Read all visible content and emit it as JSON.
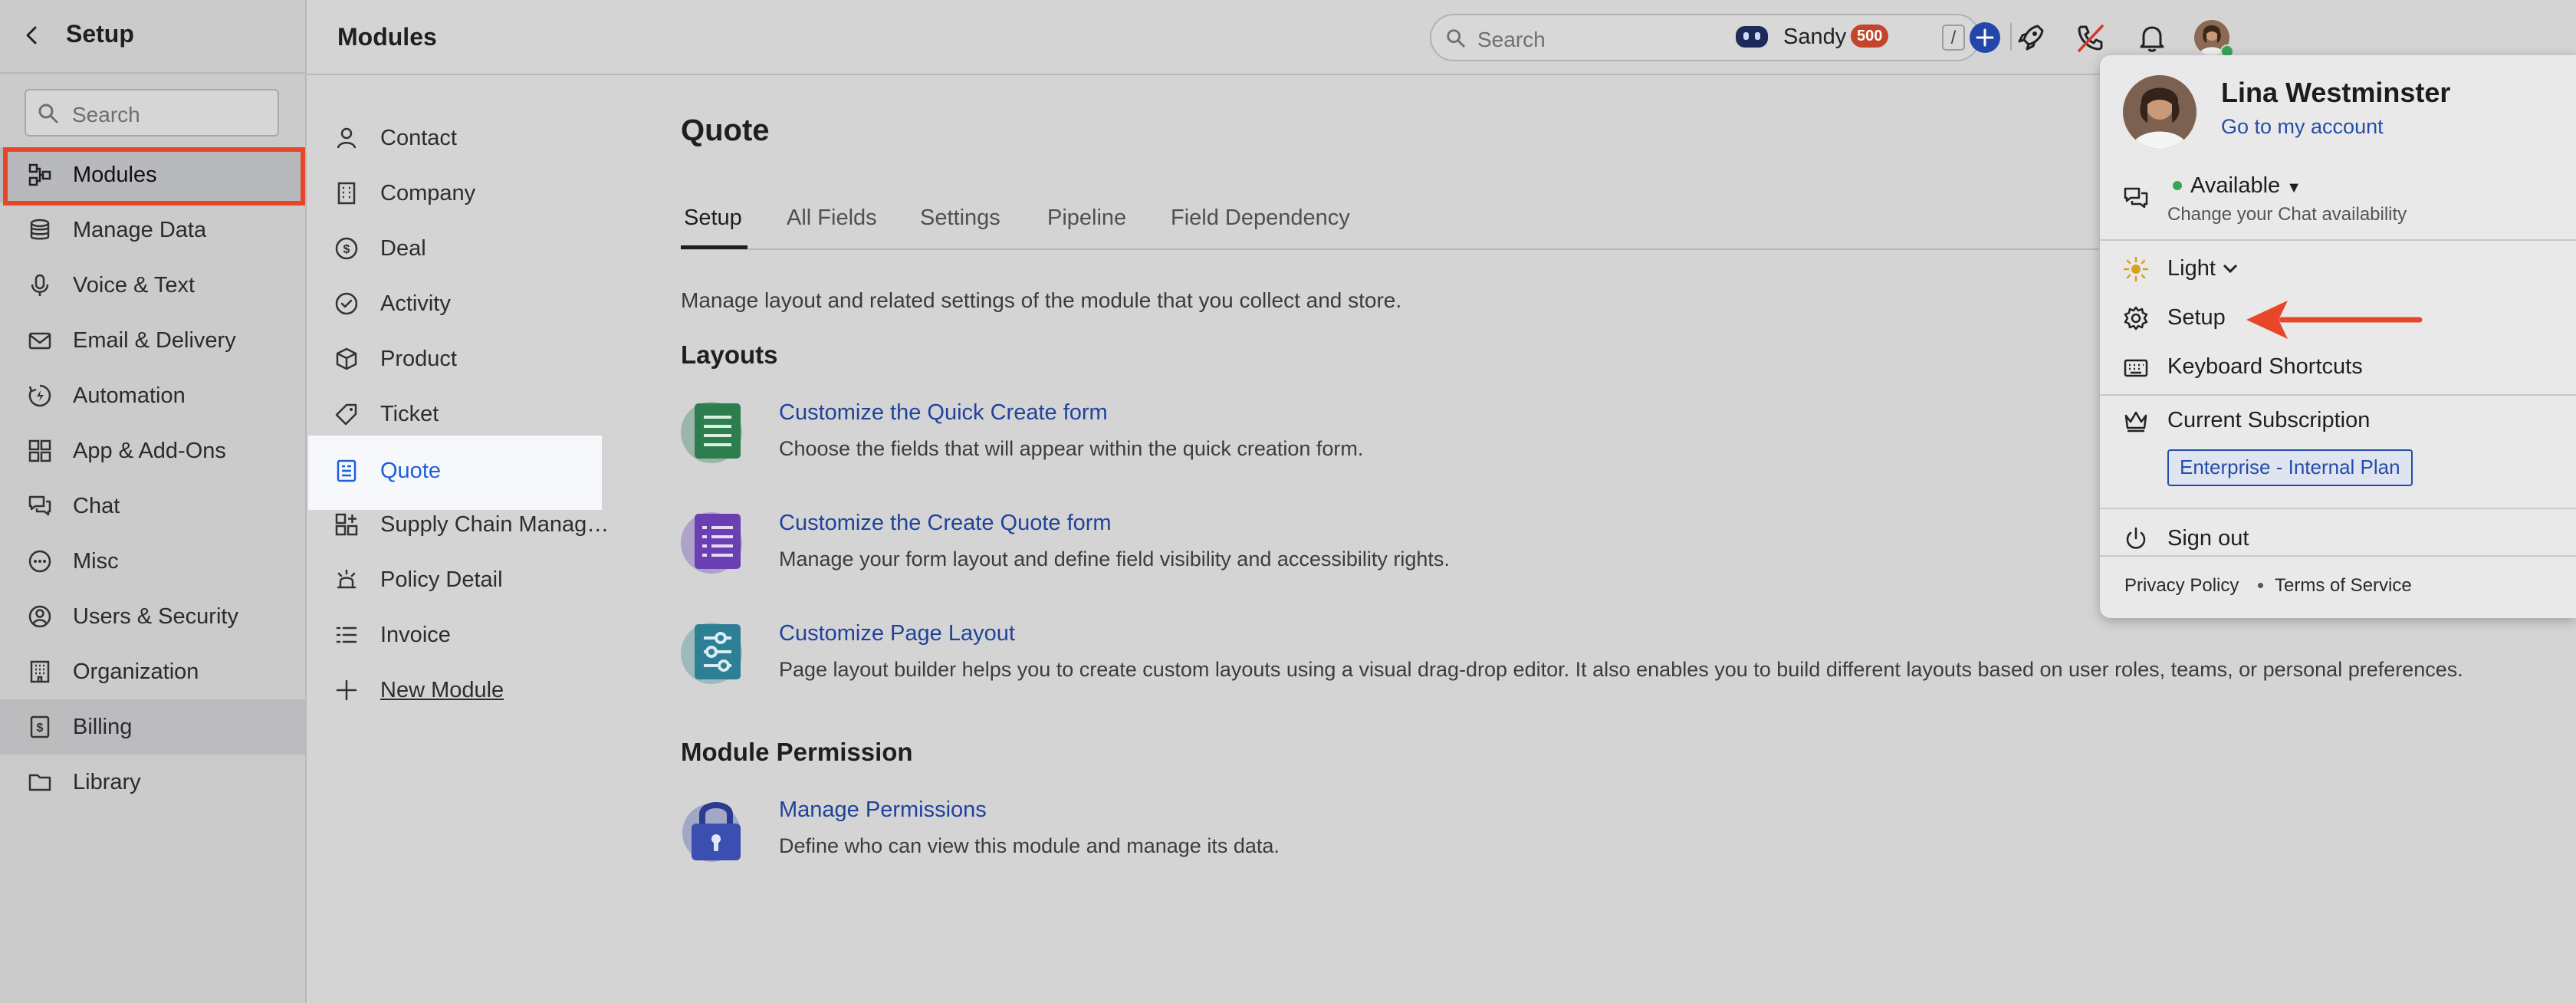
{
  "sidebar": {
    "title": "Setup",
    "search_placeholder": "Search",
    "items": [
      {
        "label": "Modules",
        "icon": "modules-icon"
      },
      {
        "label": "Manage Data",
        "icon": "database-icon"
      },
      {
        "label": "Voice & Text",
        "icon": "microphone-icon"
      },
      {
        "label": "Email & Delivery",
        "icon": "mail-icon"
      },
      {
        "label": "Automation",
        "icon": "automation-icon"
      },
      {
        "label": "App & Add-Ons",
        "icon": "apps-icon"
      },
      {
        "label": "Chat",
        "icon": "chat-icon"
      },
      {
        "label": "Misc",
        "icon": "more-icon"
      },
      {
        "label": "Users & Security",
        "icon": "user-shield-icon"
      },
      {
        "label": "Organization",
        "icon": "building-icon"
      },
      {
        "label": "Billing",
        "icon": "billing-icon"
      },
      {
        "label": "Library",
        "icon": "folder-icon"
      }
    ]
  },
  "header": {
    "title": "Modules",
    "search_placeholder": "Search",
    "search_shortcut": "/",
    "user_short": "Sandy",
    "badge": "500"
  },
  "modules": {
    "items": [
      {
        "label": "Contact",
        "icon": "person-icon"
      },
      {
        "label": "Company",
        "icon": "company-icon"
      },
      {
        "label": "Deal",
        "icon": "dollar-icon"
      },
      {
        "label": "Activity",
        "icon": "check-circle-icon"
      },
      {
        "label": "Product",
        "icon": "box-icon"
      },
      {
        "label": "Ticket",
        "icon": "tag-icon"
      },
      {
        "label": "Quote",
        "icon": "quote-doc-icon"
      },
      {
        "label": "Supply Chain Manageme...",
        "icon": "grid-plus-icon"
      },
      {
        "label": "Policy Detail",
        "icon": "policy-icon"
      },
      {
        "label": "Invoice",
        "icon": "list-icon"
      },
      {
        "label": "New Module",
        "icon": "plus-icon"
      }
    ]
  },
  "main": {
    "title": "Quote",
    "tabs": [
      "Setup",
      "All Fields",
      "Settings",
      "Pipeline",
      "Field Dependency"
    ],
    "description": "Manage layout and related settings of the module that you collect and store.",
    "layouts_title": "Layouts",
    "layouts": [
      {
        "title": "Customize the Quick Create form",
        "desc": "Choose the fields that will appear within the quick creation form."
      },
      {
        "title": "Customize the Create Quote form",
        "desc": "Manage your form layout and define field visibility and accessibility rights."
      },
      {
        "title": "Customize Page Layout",
        "desc": "Page layout builder helps you to create custom layouts using a visual drag-drop editor. It also enables you to build different layouts based on user roles, teams, or personal preferences."
      }
    ],
    "permission_title": "Module Permission",
    "permission": {
      "title": "Manage Permissions",
      "desc": "Define who can view this module and manage its data."
    }
  },
  "profile_menu": {
    "name": "Lina Westminster",
    "account_link": "Go to my account",
    "status": "Available",
    "status_hint": "Change your Chat availability",
    "theme": "Light",
    "setup": "Setup",
    "shortcuts": "Keyboard Shortcuts",
    "subscription": "Current Subscription",
    "plan": "Enterprise - Internal Plan",
    "sign_out": "Sign out",
    "privacy": "Privacy Policy",
    "terms": "Terms of Service"
  },
  "colors": {
    "highlight": "#e8462b",
    "link": "#20439a",
    "active_link": "#1f5fd6",
    "badge": "#c4452b",
    "primary_button": "#2446a8"
  }
}
